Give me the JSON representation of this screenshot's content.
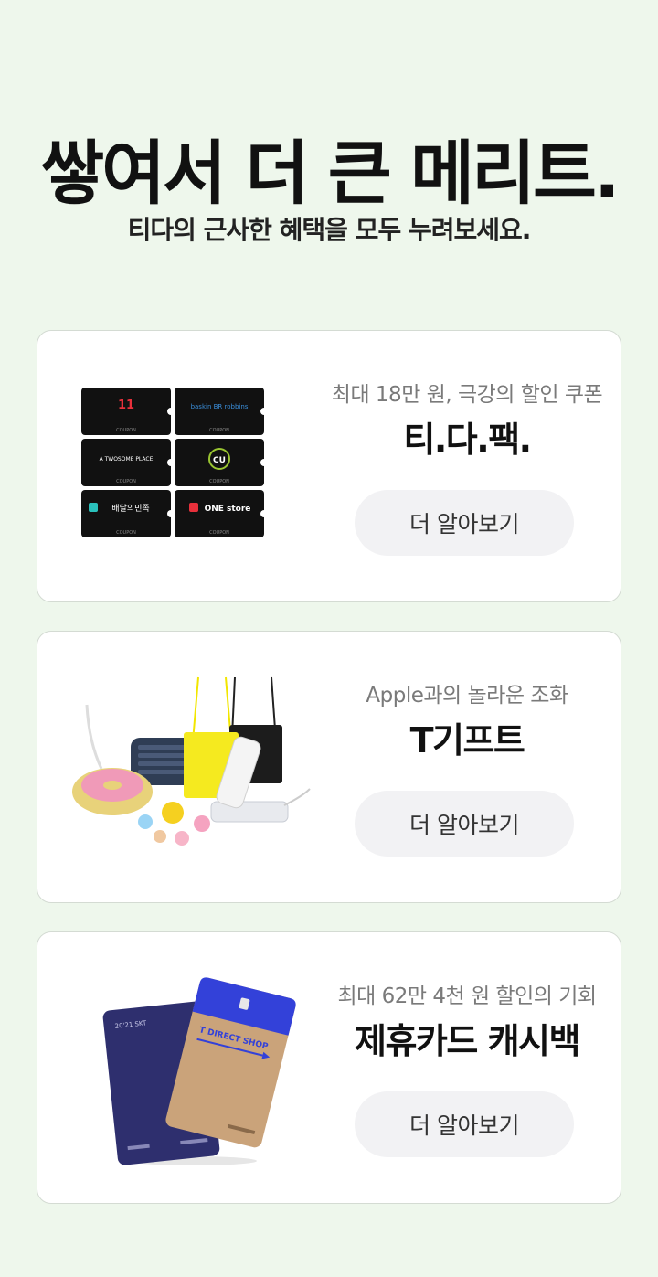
{
  "hero": {
    "title": "쌓여서 더 큰 메리트.",
    "subtitle": "티다의 근사한 혜택을 모두 누려보세요."
  },
  "cards": [
    {
      "subtitle": "최대 18만 원, 극강의 할인 쿠폰",
      "title": "티.다.팩.",
      "button": "더 알아보기",
      "coupons": [
        {
          "label": "11",
          "color": "#e8303b"
        },
        {
          "label": "baskin BR robbins",
          "color": "#3a8dd8"
        },
        {
          "label": "A TWOSOME PLACE",
          "color": "#ffffff"
        },
        {
          "label": "CU",
          "color": "#9ac531"
        },
        {
          "label": "배달의민족",
          "color": "#ffffff"
        },
        {
          "label": "ONE store",
          "color": "#ffffff"
        }
      ],
      "coupon_caption": "COUPON"
    },
    {
      "subtitle": "Apple과의 놀라운 조화",
      "title": "T기프트",
      "button": "더 알아보기"
    },
    {
      "subtitle": "최대 62만 4천 원 할인의 기회",
      "title": "제휴카드 캐시백",
      "button": "더 알아보기",
      "card_front_text": "T DIRECT SHOP",
      "card_back_text": "20'21 SKT"
    }
  ]
}
